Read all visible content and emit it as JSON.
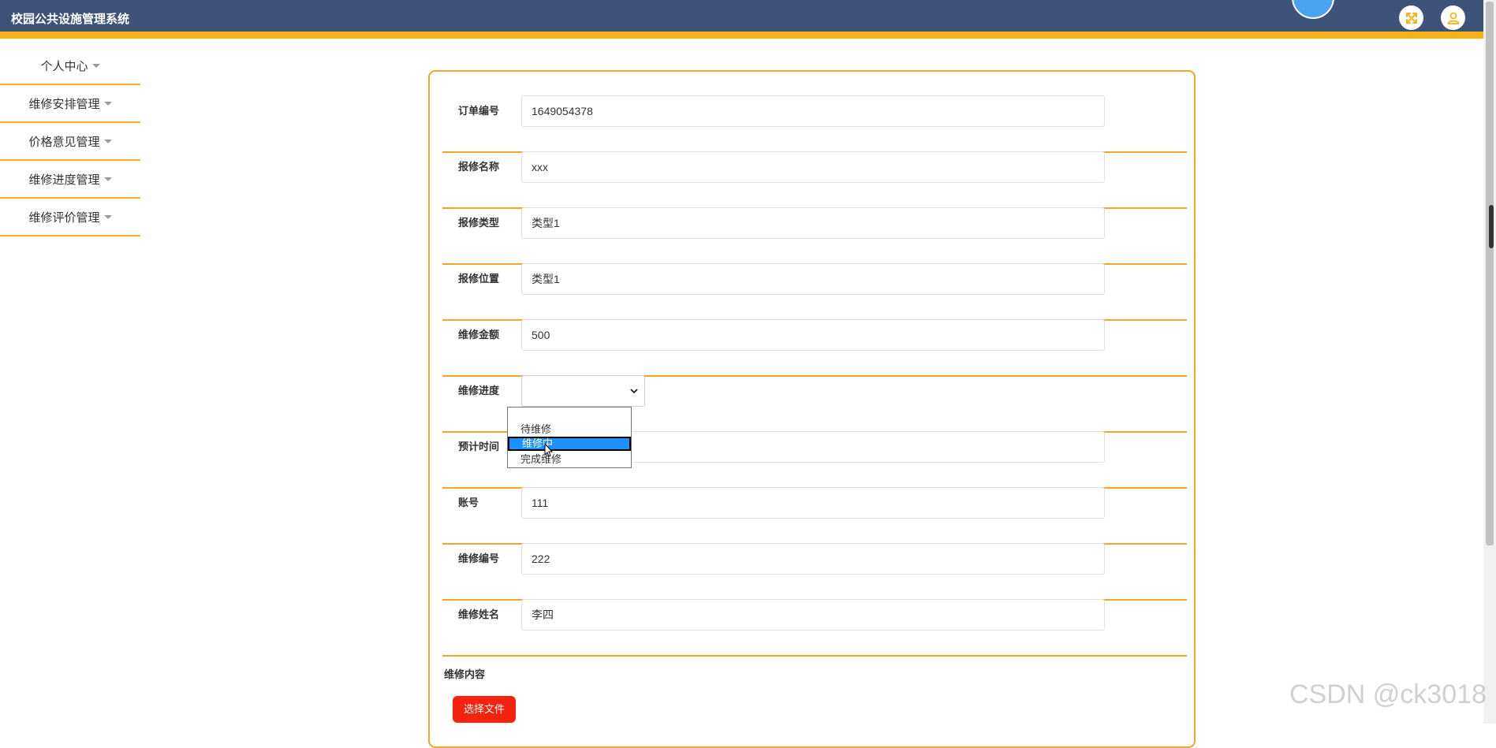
{
  "header": {
    "title": "校园公共设施管理系统"
  },
  "sidebar": {
    "items": [
      {
        "label": "个人中心"
      },
      {
        "label": "维修安排管理"
      },
      {
        "label": "价格意见管理"
      },
      {
        "label": "维修进度管理"
      },
      {
        "label": "维修评价管理"
      }
    ]
  },
  "form": {
    "order_no": {
      "label": "订单编号",
      "value": "1649054378"
    },
    "repair_name": {
      "label": "报修名称",
      "value": "xxx"
    },
    "repair_type": {
      "label": "报修类型",
      "value": "类型1"
    },
    "repair_location": {
      "label": "报修位置",
      "value": "类型1"
    },
    "repair_amount": {
      "label": "维修金额",
      "value": "500"
    },
    "repair_progress": {
      "label": "维修进度",
      "value": ""
    },
    "estimated_time": {
      "label": "预计时间",
      "value": ""
    },
    "account": {
      "label": "账号",
      "value": "111"
    },
    "repair_no": {
      "label": "维修编号",
      "value": "222"
    },
    "repair_person": {
      "label": "维修姓名",
      "value": "李四"
    },
    "repair_content": {
      "label": "维修内容"
    },
    "upload_label": "选择文件"
  },
  "dropdown": {
    "options": [
      "",
      "待维修",
      "维修中",
      "完成维修"
    ],
    "highlighted": "维修中"
  },
  "watermark": "CSDN @ck3018",
  "colors": {
    "topbar": "#3d5478",
    "accent": "#f5b317",
    "border": "#f5a623",
    "upload": "#f5220e"
  }
}
